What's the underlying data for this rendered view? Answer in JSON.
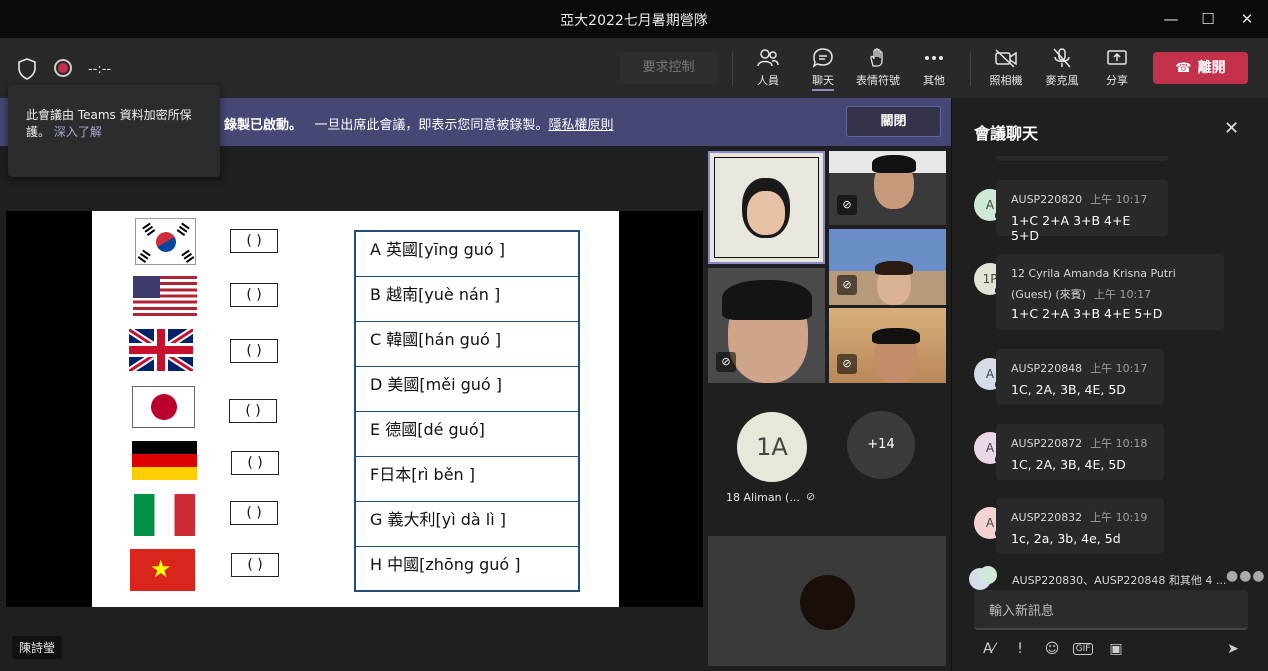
{
  "window": {
    "title": "亞大2022七月暑期營隊"
  },
  "toolbar": {
    "timer": "--:--",
    "request_control": "要求控制",
    "people": "人員",
    "chat": "聊天",
    "reactions": "表情符號",
    "more": "其他",
    "camera": "照相機",
    "mic": "麥克風",
    "share": "分享",
    "leave": "離開"
  },
  "tooltip": {
    "text": "此會議由 Teams 資料加密所保護。",
    "link": "深入了解"
  },
  "banner": {
    "prefix": "錄製已啟動。",
    "text": "一旦出席此會議，即表示您同意被錄製。",
    "link": "隱私權原則",
    "close": "關閉"
  },
  "slide": {
    "parens": [
      "(   )",
      "(   )",
      "(   )",
      "(   )",
      "(   )",
      "(   )",
      "(   )"
    ],
    "answers": [
      "A 英國[yīng guó ]",
      "B 越南[yuè nán ]",
      "C 韓國[hán guó  ]",
      "D 美國[měi guó ]",
      "E 德國[dé guó]",
      "F日本[rì běn ]",
      "G 義大利[yì dà lì ]",
      "H 中國[zhōng guó ]"
    ]
  },
  "presenter_label": "陳詩瑩",
  "gallery": {
    "avatar_initials": "1A",
    "avatar_name": "18 Aliman (...",
    "more_count": "+14"
  },
  "chat": {
    "title": "會議聊天",
    "messages": [
      {
        "avatar": "A",
        "name": "AUSP220820",
        "time": "上午 10:17",
        "body": "1+C 2+A 3+B 4+E 5+D",
        "avatar_bg": "#cfe9d9",
        "status": "#c4314b"
      },
      {
        "avatar": "1P",
        "name": "12 Cyrila Amanda Krisna Putri (Guest) (來賓)",
        "time": "上午 10:17",
        "body": "1+C 2+A 3+B 4+E 5+D",
        "avatar_bg": "#e4e4d6",
        "status": "#1f1f1f"
      },
      {
        "avatar": "A",
        "name": "AUSP220848",
        "time": "上午 10:17",
        "body": "1C, 2A, 3B, 4E, 5D",
        "avatar_bg": "#d7dde8",
        "status": "#c4314b"
      },
      {
        "avatar": "A",
        "name": "AUSP220872",
        "time": "上午 10:18",
        "body": "1C, 2A, 3B, 4E, 5D",
        "avatar_bg": "#ecd7e6",
        "status": "#f8b634"
      },
      {
        "avatar": "A",
        "name": "AUSP220832",
        "time": "上午 10:19",
        "body": "1c, 2a, 3b, 4e, 5d",
        "avatar_bg": "#f5d3d3",
        "status": "#c4314b"
      }
    ],
    "typing": "AUSP220830、AUSP220848 和其他 4 ...",
    "input_placeholder": "輸入新訊息"
  }
}
